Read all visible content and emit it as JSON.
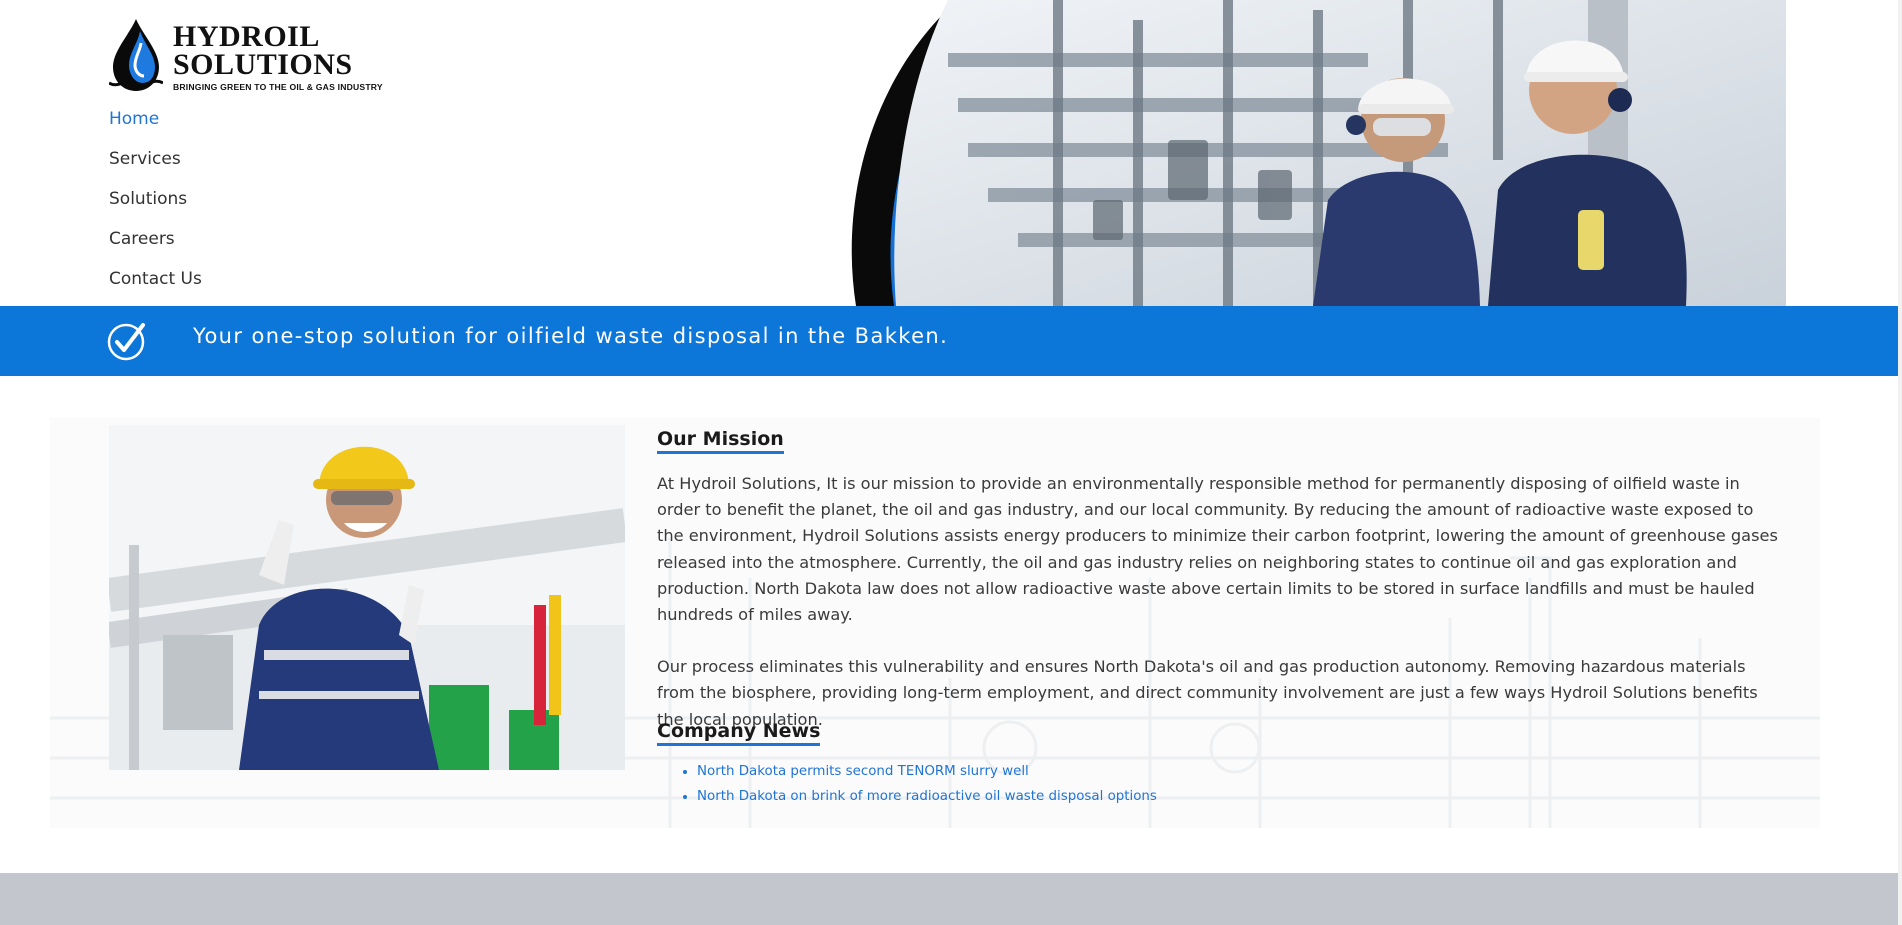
{
  "logo": {
    "line1": "HYDROIL",
    "line2": "SOLUTIONS",
    "tagline": "BRINGING GREEN TO THE OIL & GAS INDUSTRY"
  },
  "nav": {
    "items": [
      {
        "label": "Home",
        "active": true
      },
      {
        "label": "Services",
        "active": false
      },
      {
        "label": "Solutions",
        "active": false
      },
      {
        "label": "Careers",
        "active": false
      },
      {
        "label": "Contact Us",
        "active": false
      }
    ]
  },
  "banner": {
    "text": "Your one-stop solution for oilfield waste disposal in the Bakken."
  },
  "mission": {
    "title": "Our Mission",
    "paragraphs": [
      "At Hydroil Solutions, It is our mission to provide an environmentally responsible method for permanently disposing of oilfield waste in order to benefit the planet, the oil and gas industry, and our local community. By reducing the amount of radioactive waste exposed to the environment, Hydroil Solutions assists energy producers to minimize their carbon footprint, lowering the amount of greenhouse gases released into the atmosphere. Currently, the oil and gas industry relies on neighboring states to continue oil and gas exploration and production. North Dakota law does not allow radioactive waste above certain limits to be stored in surface landfills and must be hauled hundreds of miles away.",
      "Our process eliminates this vulnerability and ensures North Dakota's oil and gas production autonomy. Removing hazardous materials from the biosphere, providing long-term employment, and direct community involvement are just a few ways Hydroil Solutions benefits the local population."
    ]
  },
  "news": {
    "title": "Company News",
    "items": [
      "North Dakota permits second TENORM slurry well",
      "North Dakota on brink of more radioactive oil waste disposal options"
    ]
  },
  "colors": {
    "accent": "#0c76d9",
    "link": "#1f74d4",
    "footer": "#c3c6cc"
  },
  "icons": [
    "water-drop-logo-icon",
    "checkmark-circle-icon"
  ]
}
